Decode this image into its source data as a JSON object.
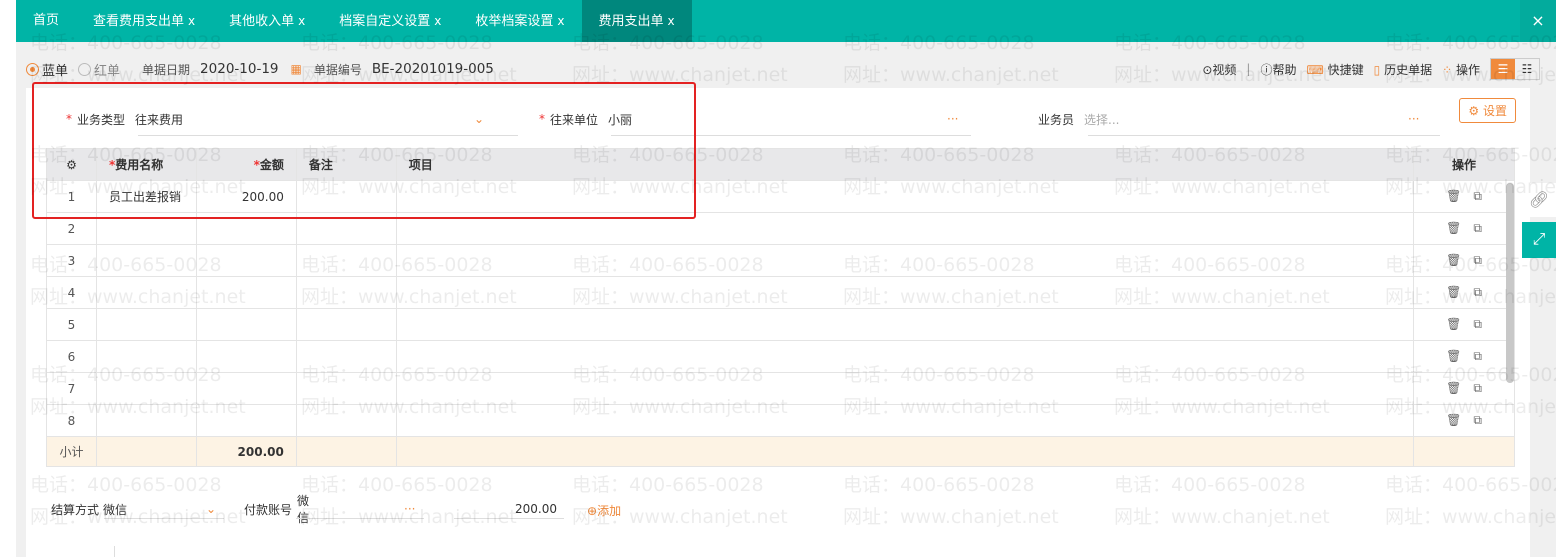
{
  "tabs": [
    {
      "label": "首页",
      "closable": false
    },
    {
      "label": "查看费用支出单",
      "closable": true
    },
    {
      "label": "其他收入单",
      "closable": true
    },
    {
      "label": "档案自定义设置",
      "closable": true
    },
    {
      "label": "枚举档案设置",
      "closable": true
    },
    {
      "label": "费用支出单",
      "closable": true,
      "active": true
    }
  ],
  "close_glyph": "×",
  "header": {
    "radio_blue": "蓝单",
    "radio_red": "红单",
    "selected": "蓝单",
    "date_label": "单据日期",
    "date": "2020-10-19",
    "code_label": "单据编号",
    "code": "BE-20201019-005"
  },
  "tools": {
    "video": "视频",
    "help": "帮助",
    "shortcut": "快捷键",
    "history": "历史单据",
    "operate": "操作"
  },
  "form": {
    "biz_type_label": "业务类型",
    "biz_type": "往来费用",
    "partner_label": "往来单位",
    "partner": "小丽",
    "salesman_label": "业务员",
    "salesman_placeholder": "选择...",
    "settings": "设置"
  },
  "table": {
    "columns": [
      "费用名称",
      "金额",
      "备注",
      "项目",
      "操作"
    ],
    "rows": [
      {
        "no": "1",
        "name": "员工出差报销",
        "amount": "200.00"
      },
      {
        "no": "2"
      },
      {
        "no": "3"
      },
      {
        "no": "4"
      },
      {
        "no": "5"
      },
      {
        "no": "6"
      },
      {
        "no": "7"
      },
      {
        "no": "8"
      }
    ],
    "subtotal_label": "小计",
    "subtotal": "200.00"
  },
  "payment": {
    "method_label": "结算方式",
    "method": "微信",
    "account_label": "付款账号",
    "account": "微信",
    "amount": "200.00",
    "add": "添加"
  },
  "watermark": {
    "phone": "电话：400-665-0028",
    "site": "网址：www.chanjet.net"
  },
  "colors": {
    "accent": "#00b4a6",
    "active_tab": "#00877d",
    "orange": "#f08a3c",
    "highlight": "#e32222"
  }
}
